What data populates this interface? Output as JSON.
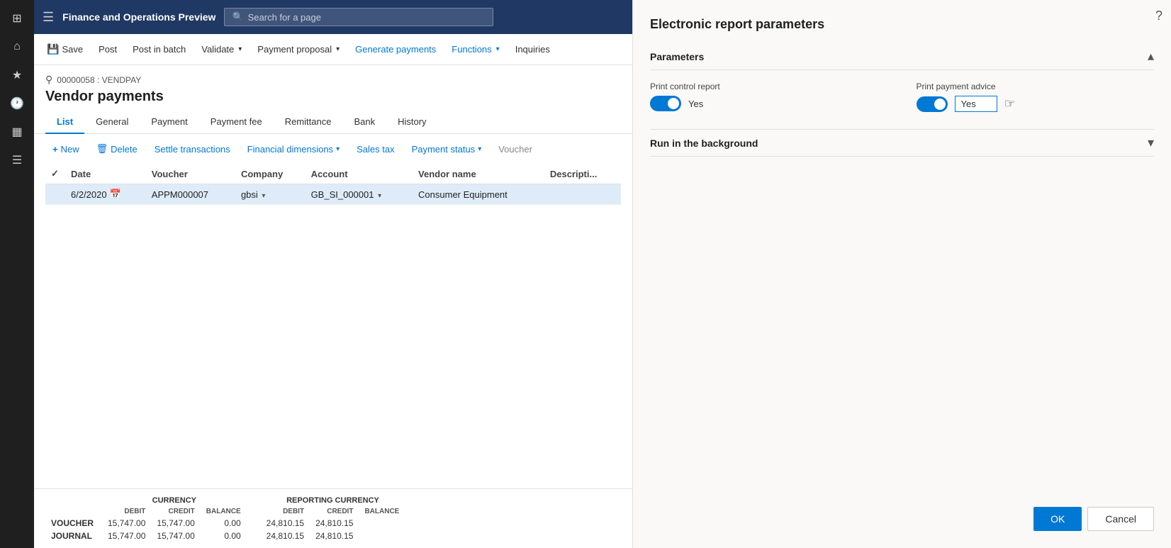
{
  "app": {
    "title": "Finance and Operations Preview",
    "search_placeholder": "Search for a page"
  },
  "toolbar": {
    "save_label": "Save",
    "post_label": "Post",
    "post_batch_label": "Post in batch",
    "validate_label": "Validate",
    "payment_proposal_label": "Payment proposal",
    "generate_payments_label": "Generate payments",
    "functions_label": "Functions",
    "inquiries_label": "Inquiries"
  },
  "page": {
    "breadcrumb_id": "00000058 : VENDPAY",
    "title": "Vendor payments",
    "tabs": [
      "List",
      "General",
      "Payment",
      "Payment fee",
      "Remittance",
      "Bank",
      "History"
    ],
    "active_tab": "List"
  },
  "actions": {
    "new_label": "New",
    "delete_label": "Delete",
    "settle_label": "Settle transactions",
    "financial_dim_label": "Financial dimensions",
    "sales_tax_label": "Sales tax",
    "payment_status_label": "Payment status",
    "voucher_label": "Voucher"
  },
  "table": {
    "columns": [
      "",
      "Date",
      "Voucher",
      "Company",
      "Account",
      "Vendor name",
      "Descripti..."
    ],
    "rows": [
      {
        "selected": true,
        "date": "6/2/2020",
        "voucher": "APPM000007",
        "company": "gbsi",
        "account": "GB_SI_000001",
        "vendor_name": "Consumer Equipment",
        "description": ""
      }
    ]
  },
  "summary": {
    "currency_label": "CURRENCY",
    "reporting_currency_label": "REPORTING CURRENCY",
    "debit_header": "DEBIT",
    "credit_header": "CREDIT",
    "balance_header": "BALANCE",
    "rows": [
      {
        "label": "VOUCHER",
        "debit": "15,747.00",
        "credit": "15,747.00",
        "balance": "0.00",
        "r_debit": "24,810.15",
        "r_credit": "24,810.15",
        "r_balance": ""
      },
      {
        "label": "JOURNAL",
        "debit": "15,747.00",
        "credit": "15,747.00",
        "balance": "0.00",
        "r_debit": "24,810.15",
        "r_credit": "24,810.15",
        "r_balance": ""
      }
    ]
  },
  "panel": {
    "title": "Electronic report parameters",
    "parameters_section": "Parameters",
    "run_background_section": "Run in the background",
    "print_control_report_label": "Print control report",
    "print_control_report_value": "Yes",
    "print_payment_advice_label": "Print payment advice",
    "print_payment_advice_value": "Yes",
    "ok_label": "OK",
    "cancel_label": "Cancel"
  },
  "icons": {
    "grid": "⊞",
    "home": "⌂",
    "star": "★",
    "clock": "🕐",
    "list": "☰",
    "filter": "⚲",
    "calendar": "📅",
    "chevron_down": "▾",
    "chevron_up": "▴",
    "search": "🔍",
    "plus": "+",
    "trash": "🗑",
    "question": "?",
    "hand": "☞"
  }
}
